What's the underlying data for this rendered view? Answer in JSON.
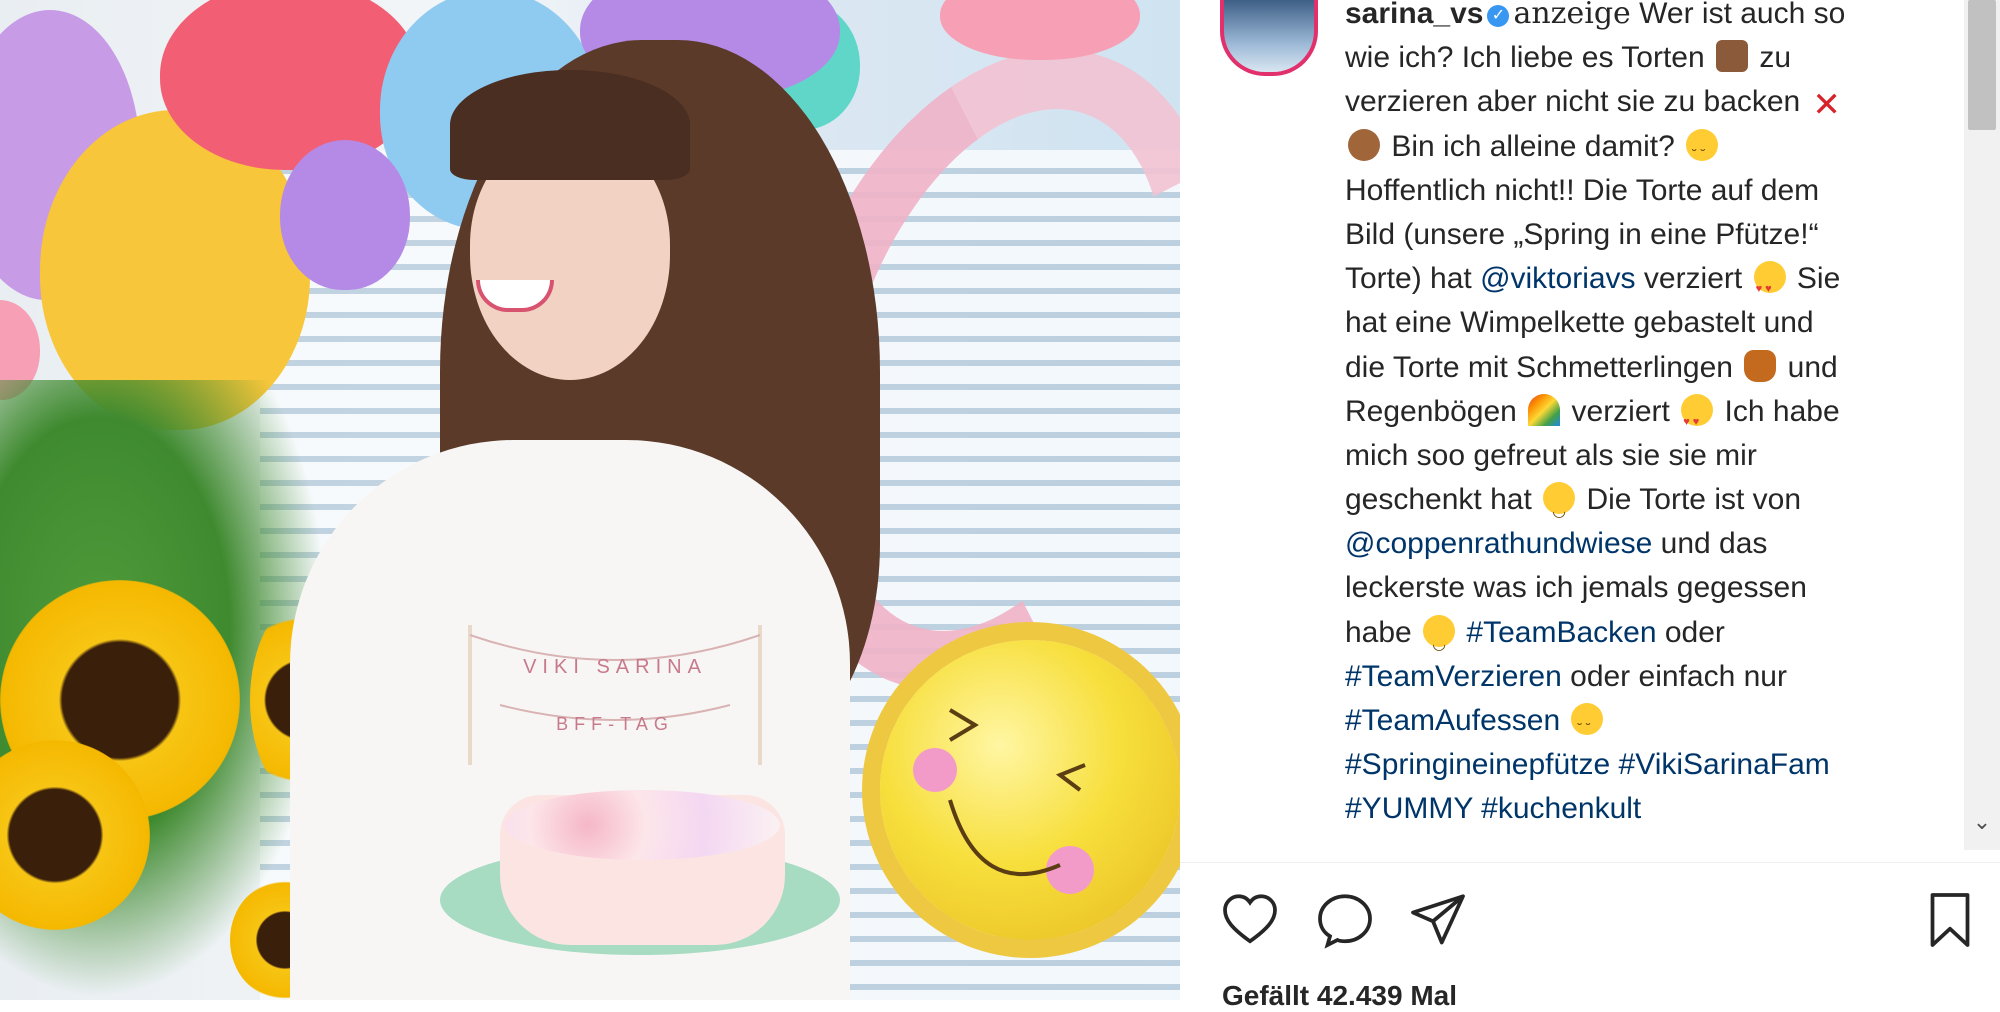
{
  "post": {
    "username": "sarina_vs",
    "sponsored_label": "anzeige",
    "likes_text": "Gefällt 42.439 Mal"
  },
  "caption_lines": [
    [
      {
        "t": "user"
      },
      {
        "t": "verified"
      },
      {
        "t": "sponsored"
      },
      {
        "t": "text",
        "v": " Wer ist auch so"
      }
    ],
    [
      {
        "t": "text",
        "v": "wie ich? Ich liebe es Torten "
      },
      {
        "t": "emoji",
        "v": "cake"
      },
      {
        "t": "text",
        "v": " zu"
      }
    ],
    [
      {
        "t": "text",
        "v": "verzieren aber nicht sie zu backen "
      },
      {
        "t": "emoji",
        "v": "x"
      }
    ],
    [
      {
        "t": "emoji",
        "v": "monkey"
      },
      {
        "t": "text",
        "v": " Bin ich alleine damit? "
      },
      {
        "t": "emoji",
        "v": "joy"
      }
    ],
    [
      {
        "t": "text",
        "v": "Hoffentlich nicht!! Die Torte auf dem"
      }
    ],
    [
      {
        "t": "text",
        "v": "Bild (unsere „Spring in eine Pfütze!“"
      }
    ],
    [
      {
        "t": "text",
        "v": "Torte) hat "
      },
      {
        "t": "mention",
        "v": "@viktoriavs"
      },
      {
        "t": "text",
        "v": " verziert "
      },
      {
        "t": "emoji",
        "v": "heart-eyes"
      },
      {
        "t": "text",
        "v": " Sie"
      }
    ],
    [
      {
        "t": "text",
        "v": "hat eine Wimpelkette gebastelt und"
      }
    ],
    [
      {
        "t": "text",
        "v": "die Torte mit Schmetterlingen "
      },
      {
        "t": "emoji",
        "v": "butterfly"
      },
      {
        "t": "text",
        "v": " und"
      }
    ],
    [
      {
        "t": "text",
        "v": "Regenbögen "
      },
      {
        "t": "emoji",
        "v": "rainbow"
      },
      {
        "t": "text",
        "v": " verziert "
      },
      {
        "t": "emoji",
        "v": "heart-eyes"
      },
      {
        "t": "text",
        "v": " Ich habe"
      }
    ],
    [
      {
        "t": "text",
        "v": "mich soo gefreut als sie sie mir"
      }
    ],
    [
      {
        "t": "text",
        "v": "geschenkt hat "
      },
      {
        "t": "emoji",
        "v": "smile"
      },
      {
        "t": "text",
        "v": " Die Torte ist von"
      }
    ],
    [
      {
        "t": "mention",
        "v": "@coppenrathundwiese"
      },
      {
        "t": "text",
        "v": " und das"
      }
    ],
    [
      {
        "t": "text",
        "v": "leckerste was ich jemals gegessen"
      }
    ],
    [
      {
        "t": "text",
        "v": "habe "
      },
      {
        "t": "emoji",
        "v": "smile"
      },
      {
        "t": "text",
        "v": " "
      },
      {
        "t": "hashtag",
        "v": "#TeamBacken"
      },
      {
        "t": "text",
        "v": " oder"
      }
    ],
    [
      {
        "t": "hashtag",
        "v": "#TeamVerzieren"
      },
      {
        "t": "text",
        "v": " oder einfach nur"
      }
    ],
    [
      {
        "t": "hashtag",
        "v": "#TeamAufessen"
      },
      {
        "t": "text",
        "v": " "
      },
      {
        "t": "emoji",
        "v": "joy"
      }
    ],
    [
      {
        "t": "hashtag",
        "v": "#Springineinepfütze"
      },
      {
        "t": "text",
        "v": " "
      },
      {
        "t": "hashtag",
        "v": "#VikiSarinaFam"
      }
    ],
    [
      {
        "t": "hashtag",
        "v": "#YUMMY"
      },
      {
        "t": "text",
        "v": " "
      },
      {
        "t": "hashtag",
        "v": "#kuchenkult"
      }
    ]
  ],
  "photo": {
    "banner_line1": "VIKI SARINA",
    "banner_line2": "BFF-TAG",
    "balloon_colors": [
      "#c79be6",
      "#f7c63a",
      "#f25f75",
      "#8fcaf0",
      "#b58ae6",
      "#5fd6c8",
      "#f7a0b5"
    ]
  },
  "icons": {
    "like": "heart-icon",
    "comment": "comment-bubble-icon",
    "share": "paper-plane-icon",
    "save": "bookmark-icon",
    "verified": "verified-badge-icon",
    "scroll_down": "chevron-down-icon"
  },
  "colors": {
    "link": "#003569",
    "verified": "#3897f0",
    "text": "#262626"
  }
}
